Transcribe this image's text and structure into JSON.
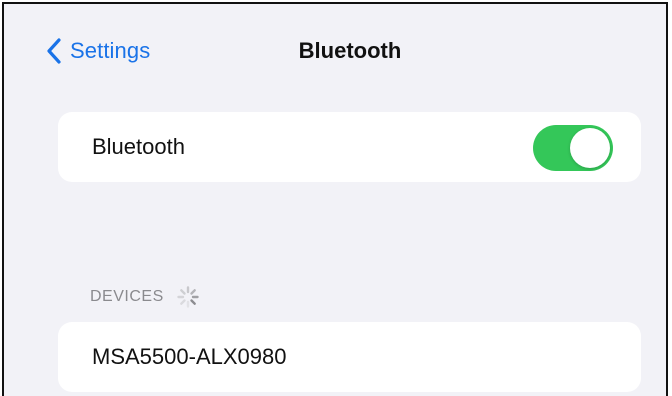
{
  "nav": {
    "back_label": "Settings",
    "title": "Bluetooth"
  },
  "bluetooth_row": {
    "label": "Bluetooth",
    "toggle_on": true
  },
  "devices_section": {
    "header": "DEVICES",
    "scanning": true,
    "devices": [
      {
        "name": "MSA5500-ALX0980"
      }
    ]
  },
  "colors": {
    "accent": "#1a73e8",
    "toggle_on": "#34c759",
    "background": "#f2f2f7",
    "card": "#ffffff",
    "section_header": "#8a8a8e"
  },
  "icons": {
    "back": "chevron-left-icon",
    "scanning": "activity-spinner-icon"
  }
}
